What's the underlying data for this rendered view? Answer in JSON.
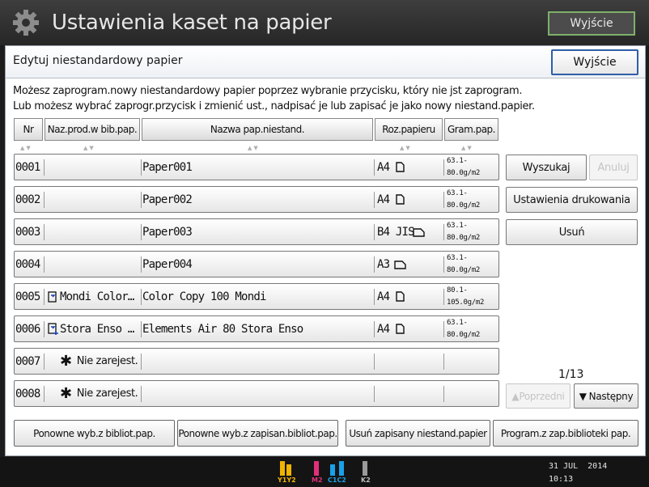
{
  "window": {
    "title": "Ustawienia kaset na papier",
    "exit_label": "Wyjście"
  },
  "panel": {
    "title": "Edytuj niestandardowy papier",
    "exit_label": "Wyjście",
    "info_line1": "Możesz zaprogram.nowy niestandardowy papier poprzez wybranie przycisku, który nie jst zaprogram.",
    "info_line2": "Lub możesz wybrać zaprogr.przycisk i zmienić ust., nadpisać je lub zapisać je jako nowy niestand.papier."
  },
  "columns": {
    "nr": "Nr",
    "lib_name": "Naz.prod.w bib.pap.",
    "custom_name": "Nazwa pap.niestand.",
    "paper_size": "Roz.papieru",
    "weight": "Gram.pap."
  },
  "sort_indicator": "▲▼",
  "rows": [
    {
      "nr": "0001",
      "lib": "",
      "name": "Paper001",
      "size": "A4",
      "gram1": "63.1-",
      "gram2": "80.0g/m2"
    },
    {
      "nr": "0002",
      "lib": "",
      "name": "Paper002",
      "size": "A4",
      "gram1": "63.1-",
      "gram2": "80.0g/m2"
    },
    {
      "nr": "0003",
      "lib": "",
      "name": "Paper003",
      "size": "B4 JIS",
      "gram1": "63.1-",
      "gram2": "80.0g/m2"
    },
    {
      "nr": "0004",
      "lib": "",
      "name": "Paper004",
      "size": "A3",
      "gram1": "63.1-",
      "gram2": "80.0g/m2"
    },
    {
      "nr": "0005",
      "lib": "Mondi Color…",
      "name": "Color Copy 100 Mondi",
      "size": "A4",
      "gram1": "80.1-",
      "gram2": "105.0g/m2"
    },
    {
      "nr": "0006",
      "lib": "Stora Enso …",
      "name": "Elements Air 80 Stora Enso",
      "size": "A4",
      "gram1": "63.1-",
      "gram2": "80.0g/m2"
    },
    {
      "nr": "0007",
      "star": "✱",
      "unreg": "Nie zarejest."
    },
    {
      "nr": "0008",
      "star": "✱",
      "unreg": "Nie zarejest."
    }
  ],
  "side": {
    "search": "Wyszukaj",
    "cancel": "Anuluj",
    "print_settings": "Ustawienia drukowania",
    "delete": "Usuń",
    "page": "1/13",
    "prev": "Poprzedni",
    "next": "Następny",
    "prev_icon": "▲",
    "next_icon": "▼"
  },
  "bottom": {
    "btn1": "Ponowne wyb.z bibliot.pap.",
    "btn2": "Ponowne wyb.z zapisan.bibliot.pap.",
    "btn3": "Usuń zapisany niestand.papier",
    "btn4": "Program.z zap.biblioteki pap."
  },
  "status": {
    "toner_labels": [
      "Y1Y2",
      "M2",
      "C1C2",
      "K2"
    ],
    "date": "31 JUL  2014",
    "time": "10:13"
  },
  "colors": {
    "accent_blue": "#2e5ea8",
    "exit_green": "#7fb06a",
    "yellow": "#f0b400",
    "magenta": "#e0307a",
    "cyan": "#1aa0e8"
  },
  "icons": [
    "gear-icon",
    "portrait-paper-icon",
    "landscape-paper-icon",
    "library-link-icon",
    "asterisk-icon"
  ]
}
